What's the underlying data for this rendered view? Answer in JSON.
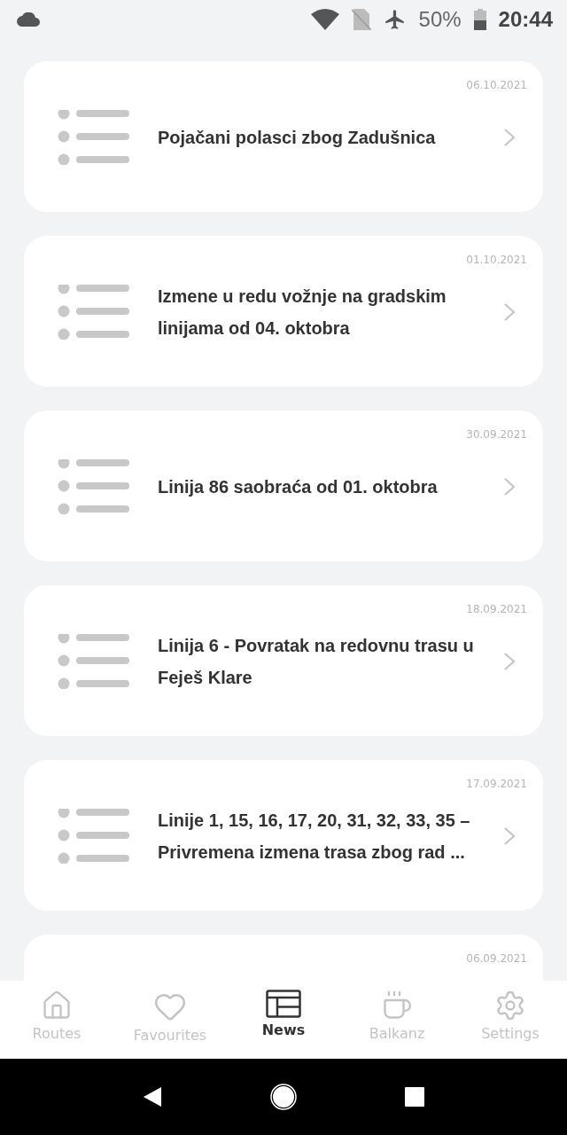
{
  "status_bar": {
    "battery": "50%",
    "time": "20:44"
  },
  "news": [
    {
      "date": "06.10.2021",
      "title": "Pojačani polasci zbog Zadušnica"
    },
    {
      "date": "01.10.2021",
      "title": "Izmene u redu vožnje na gradskim linijama od 04. oktobra"
    },
    {
      "date": "30.09.2021",
      "title": "Linija 86 saobraća od 01. oktobra"
    },
    {
      "date": "18.09.2021",
      "title": "Linija 6 - Povratak na redovnu trasu u Feješ Klare"
    },
    {
      "date": "17.09.2021",
      "title": "Linije 1, 15, 16, 17, 20, 31, 32, 33, 35 – Privremena izmena trasa zbog rad ..."
    },
    {
      "date": "06.09.2021"
    }
  ],
  "tabs": [
    {
      "kind": "home",
      "label": "Routes",
      "selected": false
    },
    {
      "kind": "heart",
      "label": "Favourites",
      "selected": false
    },
    {
      "kind": "news",
      "label": "News",
      "selected": true
    },
    {
      "kind": "coffee",
      "label": "Balkanz",
      "selected": false
    },
    {
      "kind": "gear",
      "label": "Settings",
      "selected": false
    }
  ]
}
